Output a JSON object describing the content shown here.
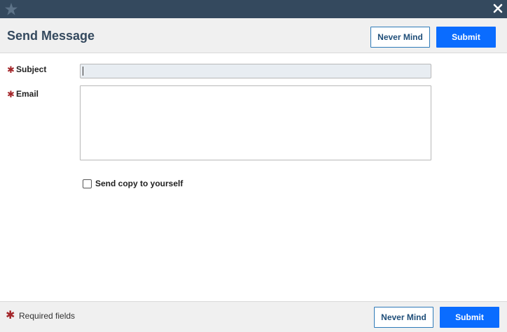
{
  "titlebar": {
    "logo_icon": "star-logo-icon",
    "close_icon": "close-icon",
    "background": "#34495e"
  },
  "header": {
    "title": "Send Message",
    "never_mind_label": "Never Mind",
    "submit_label": "Submit"
  },
  "form": {
    "required_marker": "✱",
    "subject": {
      "label": "Subject",
      "value": "",
      "placeholder": ""
    },
    "email": {
      "label": "Email",
      "value": "",
      "placeholder": ""
    },
    "send_copy": {
      "label": "Send copy to yourself",
      "checked": false
    }
  },
  "footer": {
    "required_marker": "✱",
    "required_text": "Required fields",
    "never_mind_label": "Never Mind",
    "submit_label": "Submit"
  },
  "colors": {
    "accent": "#0a6cff",
    "required": "#a3262a",
    "title": "#34495e"
  }
}
